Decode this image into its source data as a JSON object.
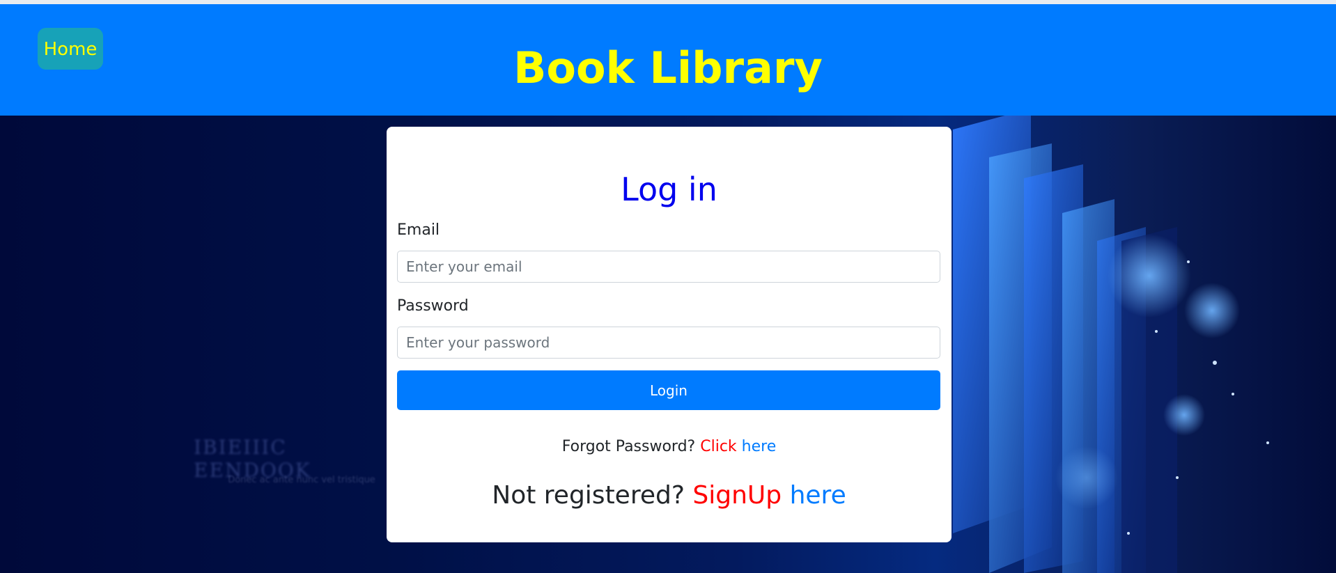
{
  "header": {
    "home_label": "Home",
    "title": "Book Library"
  },
  "background": {
    "faded_heading": "IBIEIIIC EENDOOK",
    "faded_subtitle": "Donec ac ante nunc vel tristique"
  },
  "login": {
    "title": "Log in",
    "email_label": "Email",
    "email_placeholder": "Enter your email",
    "email_value": "",
    "password_label": "Password",
    "password_placeholder": "Enter your password",
    "password_value": "",
    "submit_label": "Login",
    "forgot_prefix": "Forgot Password?",
    "forgot_click": "Click",
    "forgot_link": "here",
    "signup_prefix": "Not registered?",
    "signup_word": "SignUp",
    "signup_link": "here"
  },
  "colors": {
    "header_bg": "#007bff",
    "title_yellow": "#ffff00",
    "home_button_bg": "#17a2b8",
    "login_title_blue": "#0000ee",
    "link_blue": "#007bff",
    "accent_red": "#ff0000"
  }
}
